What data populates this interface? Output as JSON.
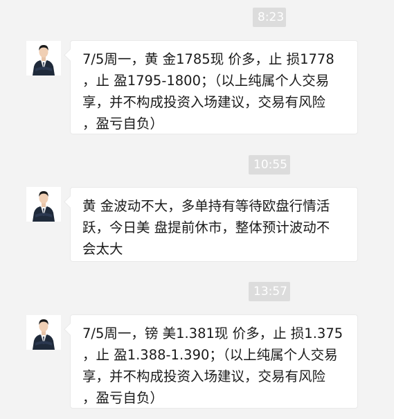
{
  "chat": {
    "messages": [
      {
        "time": "8:23",
        "text": "7/5周一，黄 金1785现 价多，止 损1778\n，止 盈1795-1800；（以上纯属个人交易\n享，并不构成投资入场建议，交易有风险\n，盈亏自负）"
      },
      {
        "time": "10:55",
        "text": "黄 金波动不大，多单持有等待欧盘行情活\n跃，今日美 盘提前休市，整体预计波动不\n会太大"
      },
      {
        "time": "13:57",
        "text": "7/5周一，镑 美1.381现 价多，止 损1.375\n，止 盈1.388-1.390；（以上纯属个人交易\n享，并不构成投资入场建议，交易有风险\n，盈亏自负）"
      }
    ]
  }
}
